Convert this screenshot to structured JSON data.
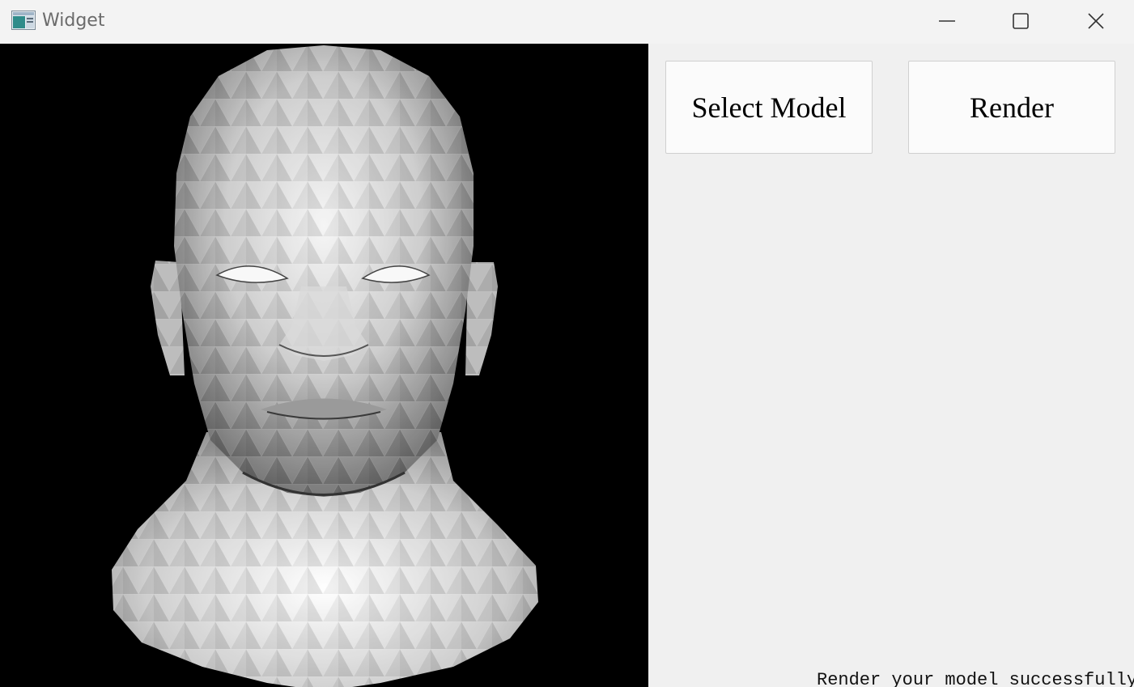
{
  "window": {
    "title": "Widget",
    "controls": {
      "minimize": "minimize-icon",
      "maximize": "maximize-icon",
      "close": "close-icon"
    }
  },
  "toolbar": {
    "select_model_label": "Select Model",
    "render_label": "Render"
  },
  "status": {
    "message": "Render your model successfully!"
  },
  "viewport": {
    "content": "rendered-3d-head-model",
    "background": "#000000"
  }
}
